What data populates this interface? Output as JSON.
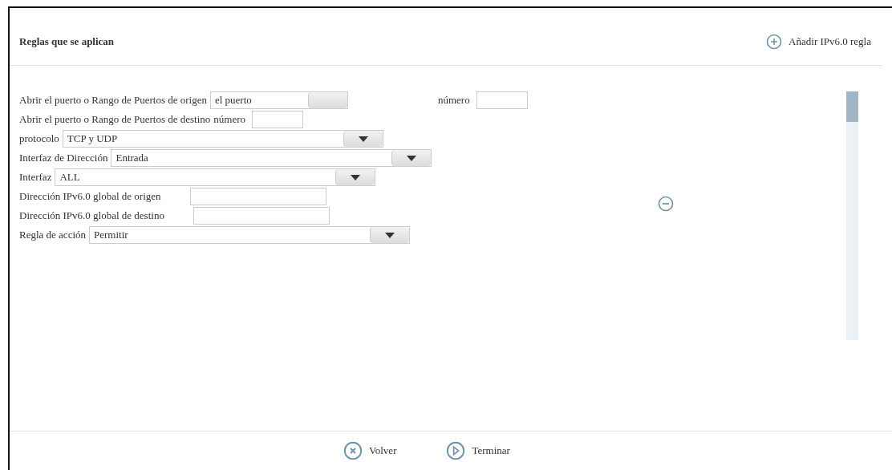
{
  "header": {
    "title": "Reglas que se aplican",
    "add_link": "Añadir IPv6.0 regla"
  },
  "rows": [
    {
      "parts": [
        {
          "kind": "label",
          "text": "Abrir el puerto o Rango de Puertos de origen"
        },
        {
          "kind": "combo",
          "value": "el puerto"
        },
        {
          "kind": "label",
          "text": "número"
        },
        {
          "kind": "input"
        }
      ]
    },
    {
      "parts": [
        {
          "kind": "label",
          "text": "Abrir el puerto o Rango de Puertos de destino"
        },
        {
          "kind": "label",
          "text": "número"
        },
        {
          "kind": "input"
        }
      ]
    },
    {
      "parts": [
        {
          "kind": "label",
          "text": "protocolo"
        },
        {
          "kind": "select",
          "value": "TCP y UDP"
        }
      ]
    },
    {
      "parts": [
        {
          "kind": "label",
          "text": "Interfaz de Dirección"
        },
        {
          "kind": "select",
          "value": "Entrada"
        }
      ]
    },
    {
      "parts": [
        {
          "kind": "label",
          "text": "Interfaz"
        },
        {
          "kind": "select",
          "value": "ALL"
        }
      ]
    },
    {
      "parts": [
        {
          "kind": "label",
          "text": "Dirección IPv6.0 global de origen"
        },
        {
          "kind": "wideinput"
        }
      ]
    },
    {
      "parts": [
        {
          "kind": "label",
          "text": "Dirección IPv6.0 global de destino"
        },
        {
          "kind": "wideinput"
        }
      ]
    },
    {
      "parts": [
        {
          "kind": "label",
          "text": "Regla de acción"
        },
        {
          "kind": "select",
          "value": "Permitir"
        }
      ]
    }
  ],
  "footer": [
    {
      "kind": "cancel",
      "label": "Volver"
    },
    {
      "kind": "finish",
      "label": "Terminar"
    }
  ]
}
